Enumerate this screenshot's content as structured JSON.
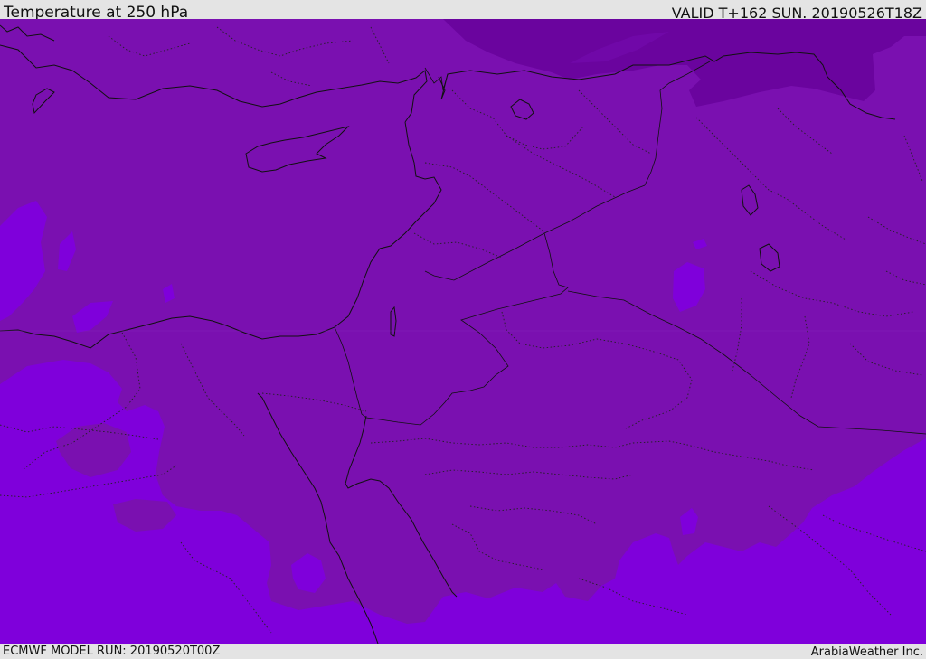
{
  "header": {
    "title": "Temperature at 250 hPa",
    "valid": "VALID T+162 SUN. 20190526T18Z"
  },
  "footer": {
    "model_run": "ECMWF MODEL RUN: 20190520T00Z",
    "credit": "ArabiaWeather Inc."
  },
  "colors": {
    "band_cold": "#6a049e",
    "band_mid": "#7a10b0",
    "band_warm": "#7f00db",
    "coastline": "#111111",
    "border_dotted": "#222222"
  }
}
